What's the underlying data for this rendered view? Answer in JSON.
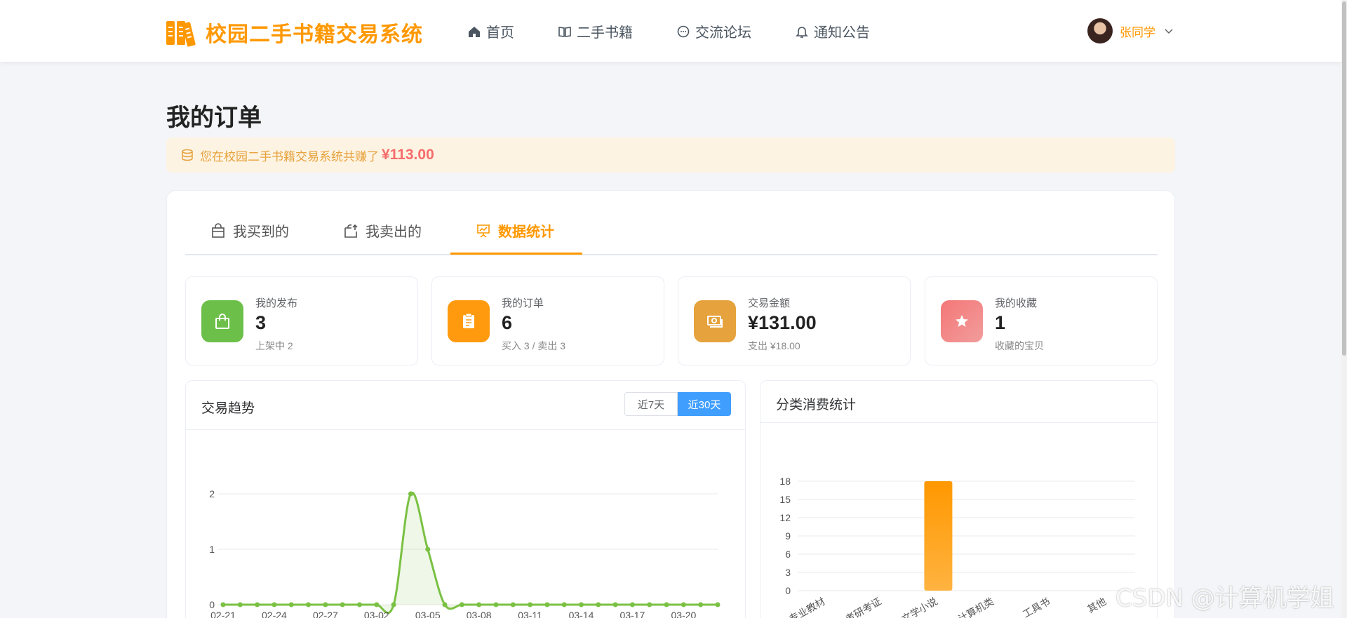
{
  "app": {
    "title": "校园二手书籍交易系统"
  },
  "nav": [
    {
      "label": "首页",
      "icon": "home-icon"
    },
    {
      "label": "二手书籍",
      "icon": "book-icon"
    },
    {
      "label": "交流论坛",
      "icon": "chat-icon"
    },
    {
      "label": "通知公告",
      "icon": "bell-icon"
    }
  ],
  "user": {
    "name": "张同学"
  },
  "page": {
    "title": "我的订单",
    "earn_text": "您在校园二手书籍交易系统共赚了",
    "earn_amount": "¥113.00"
  },
  "tabs": [
    {
      "label": "我买到的",
      "icon": "shopping-bag-icon"
    },
    {
      "label": "我卖出的",
      "icon": "sell-bag-icon"
    },
    {
      "label": "数据统计",
      "icon": "presentation-chart-icon",
      "active": true
    }
  ],
  "stats": [
    {
      "label": "我的发布",
      "value": "3",
      "sub": "上架中 2",
      "color": "#6cc04a",
      "icon": "bag-icon"
    },
    {
      "label": "我的订单",
      "value": "6",
      "sub": "买入 3 / 卖出 3",
      "color": "#ff9a0e",
      "icon": "clipboard-icon"
    },
    {
      "label": "交易金额",
      "value": "¥131.00",
      "sub": "支出 ¥18.00",
      "color": "#e6a23c",
      "icon": "money-icon"
    },
    {
      "label": "我的收藏",
      "value": "1",
      "sub": "收藏的宝贝",
      "color": "#f08585",
      "icon": "star-icon"
    }
  ],
  "trend": {
    "title": "交易趋势",
    "range_7": "近7天",
    "range_30": "近30天"
  },
  "category": {
    "title": "分类消费统计"
  },
  "watermark": "CSDN @计算机学姐",
  "colors": {
    "accent": "#ff9800",
    "primary": "#409eff",
    "line": "#7ac143"
  },
  "chart_data": [
    {
      "type": "line",
      "x": [
        "02-21",
        "02-22",
        "02-23",
        "02-24",
        "02-25",
        "02-26",
        "02-27",
        "02-28",
        "03-01",
        "03-02",
        "03-03",
        "03-04",
        "03-05",
        "03-06",
        "03-07",
        "03-08",
        "03-09",
        "03-10",
        "03-11",
        "03-12",
        "03-13",
        "03-14",
        "03-15",
        "03-16",
        "03-17",
        "03-18",
        "03-19",
        "03-20",
        "03-21",
        "03-22"
      ],
      "x_tick_labels": [
        "02-21",
        "02-24",
        "02-27",
        "03-02",
        "03-05",
        "03-08",
        "03-11",
        "03-14",
        "03-17",
        "03-20"
      ],
      "series": [
        {
          "values": [
            0,
            0,
            0,
            0,
            0,
            0,
            0,
            0,
            0,
            0,
            0,
            2,
            1,
            0,
            0,
            0,
            0,
            0,
            0,
            0,
            0,
            0,
            0,
            0,
            0,
            0,
            0,
            0,
            0,
            0
          ]
        }
      ],
      "ylim": [
        0,
        2
      ],
      "yticks": [
        0,
        1,
        2
      ],
      "grid": true
    },
    {
      "type": "bar",
      "categories": [
        "专业教材",
        "考研考证",
        "文学小说",
        "计算机类",
        "工具书",
        "其他"
      ],
      "values": [
        0,
        0,
        18,
        0,
        0,
        0
      ],
      "ylim": [
        0,
        18
      ],
      "yticks": [
        0,
        3,
        6,
        9,
        12,
        15,
        18
      ],
      "grid": true
    }
  ]
}
